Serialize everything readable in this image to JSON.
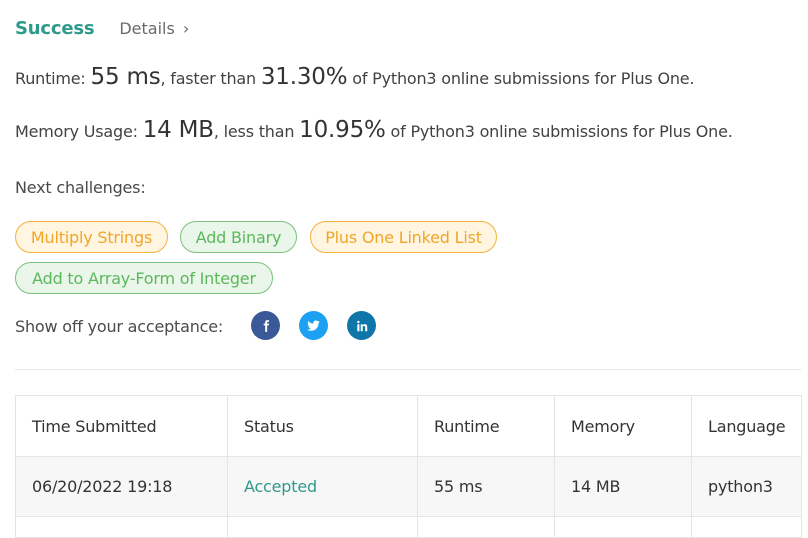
{
  "header": {
    "status_label": "Success",
    "details_label": "Details",
    "details_chevron": "›"
  },
  "runtime": {
    "label": "Runtime: ",
    "value": "55 ms",
    "mid": ", faster than ",
    "percent": "31.30%",
    "suffix": " of Python3 online submissions for Plus One."
  },
  "memory": {
    "label": "Memory Usage: ",
    "value": "14 MB",
    "mid": ", less than ",
    "percent": "10.95%",
    "suffix": " of Python3 online submissions for Plus One."
  },
  "next_challenges": {
    "label": "Next challenges:",
    "items": [
      {
        "label": "Multiply Strings",
        "difficulty": "medium"
      },
      {
        "label": "Add Binary",
        "difficulty": "easy"
      },
      {
        "label": "Plus One Linked List",
        "difficulty": "medium"
      },
      {
        "label": "Add to Array-Form of Integer",
        "difficulty": "easy"
      }
    ]
  },
  "share": {
    "label": "Show off your acceptance:",
    "icons": [
      "facebook-icon",
      "twitter-icon",
      "linkedin-icon"
    ],
    "colors": {
      "facebook": "#3b5998",
      "twitter": "#1da1f2",
      "linkedin": "#0e76a8"
    }
  },
  "colors": {
    "success": "#2e9a8a",
    "medium_chip_text": "#f0a629",
    "medium_chip_border": "#f4b13d",
    "easy_chip_text": "#5cb85c",
    "easy_chip_border": "#7cc17e"
  },
  "submissions": {
    "columns": [
      "Time Submitted",
      "Status",
      "Runtime",
      "Memory",
      "Language"
    ],
    "rows": [
      [
        "06/20/2022 19:18",
        "Accepted",
        "55 ms",
        "14 MB",
        "python3"
      ]
    ]
  }
}
